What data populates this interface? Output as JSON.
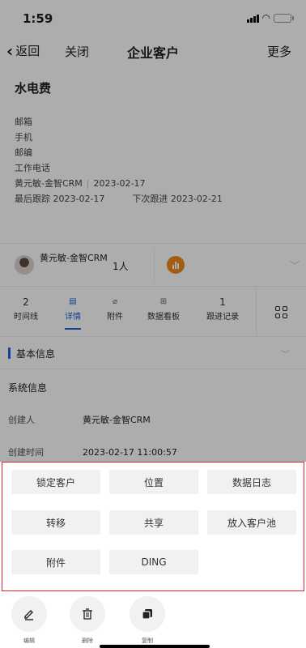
{
  "status": {
    "time": "1:59"
  },
  "nav": {
    "back": "返回",
    "close": "关闭",
    "title": "企业客户",
    "more": "更多"
  },
  "card": {
    "name": "水电费",
    "fields": [
      "邮箱",
      "手机",
      "邮编",
      "工作电话"
    ],
    "owner_line": {
      "owner": "黄元敏-金智CRM",
      "date": "2023-02-17"
    },
    "last_follow": "最后跟踪 2023-02-17",
    "next_follow": "下次跟进 2023-02-21"
  },
  "owner_row": {
    "name": "黄元敏-金智CRM",
    "count": "1人"
  },
  "tabs": [
    {
      "top": "2",
      "label": "时间线"
    },
    {
      "top": "▤",
      "label": "详情"
    },
    {
      "top": "⌀",
      "label": "附件"
    },
    {
      "top": "⊞",
      "label": "数据看板"
    },
    {
      "top": "1",
      "label": "跟进记录"
    }
  ],
  "sections": {
    "basic": "基本信息",
    "system": "系统信息",
    "creator_label": "创建人",
    "creator_value": "黄元敏-金智CRM",
    "created_label": "创建时间",
    "created_value": "2023-02-17 11:00:57"
  },
  "actions": [
    "锁定客户",
    "位置",
    "数据日志",
    "转移",
    "共享",
    "放入客户池",
    "附件",
    "DING"
  ],
  "bottom": [
    {
      "icon": "edit-icon",
      "label": "编辑"
    },
    {
      "icon": "trash-icon",
      "label": "删除"
    },
    {
      "icon": "copy-icon",
      "label": "复制"
    }
  ]
}
